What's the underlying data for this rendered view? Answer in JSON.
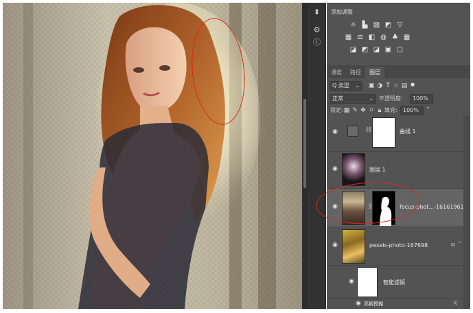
{
  "adjustments": {
    "title": "添加调整",
    "icons_row1": [
      "sun-icon",
      "levels-icon",
      "curves-icon",
      "exposure-icon",
      "triangle-icon"
    ],
    "icons_row2": [
      "vibrance-icon",
      "scale-icon",
      "colorbal-icon",
      "camera-icon",
      "mixer-icon",
      "grid-icon"
    ],
    "icons_row3": [
      "invert-icon",
      "posterize-icon",
      "threshold-icon",
      "gradient-icon",
      "selcolor-icon"
    ]
  },
  "tabs": [
    {
      "label": "通道"
    },
    {
      "label": "路径"
    },
    {
      "label": "图层"
    }
  ],
  "filter": {
    "kind_label": "Q 类型"
  },
  "blend": {
    "mode": "正常",
    "opacity_label": "不透明度:",
    "opacity_value": "100%"
  },
  "lock": {
    "label": "锁定:",
    "fill_label": "填充:",
    "fill_value": "100%"
  },
  "layers": [
    {
      "name": "曲线 1"
    },
    {
      "name": "图层 1"
    },
    {
      "name": "focus-phot...-16161961"
    },
    {
      "name": "pexels-photo-167698"
    },
    {
      "name": "智能滤镜"
    },
    {
      "name": "高斯模糊"
    }
  ]
}
